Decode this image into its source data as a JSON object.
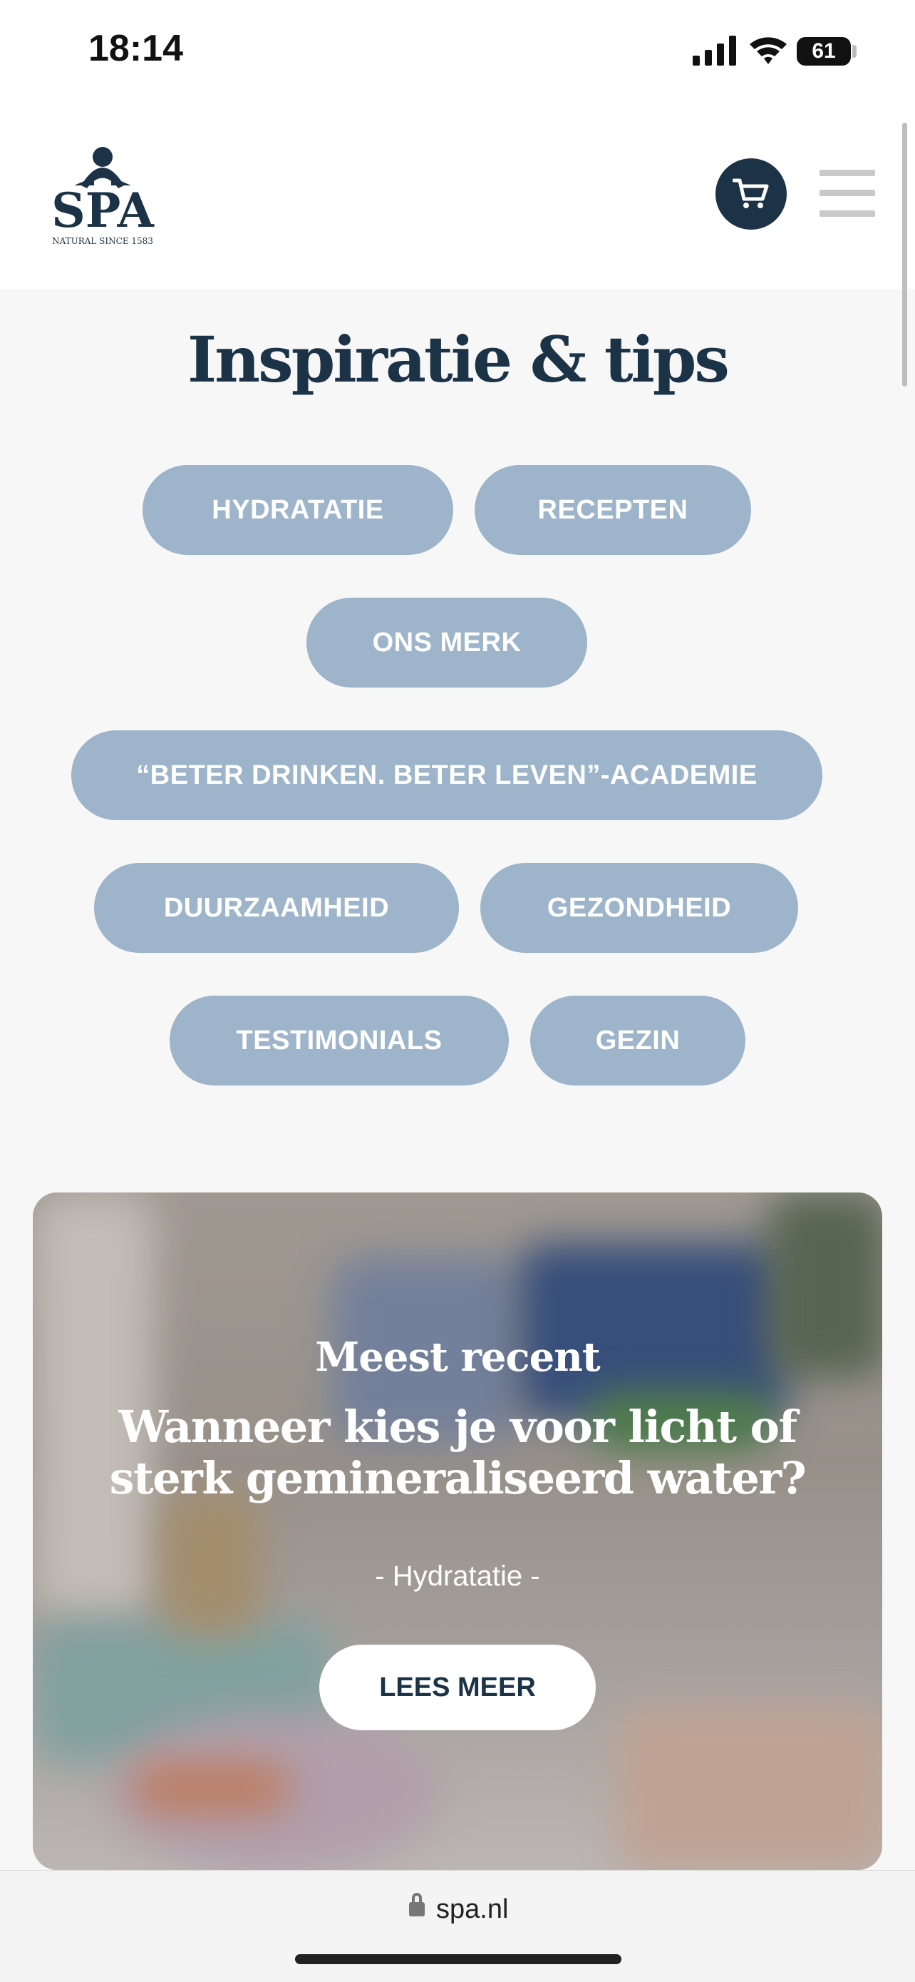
{
  "status_bar": {
    "time": "18:14",
    "battery": "61"
  },
  "header": {
    "logo_text": "SPA",
    "logo_tagline": "NATURAL SINCE 1583"
  },
  "page_title": "Inspiratie & tips",
  "categories": [
    "HYDRATATIE",
    "RECEPTEN",
    "ONS MERK",
    "“BETER DRINKEN. BETER LEVEN”-ACADEMIE",
    "DUURZAAMHEID",
    "GEZONDHEID",
    "TESTIMONIALS",
    "GEZIN"
  ],
  "hero": {
    "kicker": "Meest recent",
    "title": "Wanneer kies je voor licht of sterk gemineraliseerd water?",
    "category": "- Hydratatie -",
    "button_label": "LEES MEER"
  },
  "browser": {
    "url": "spa.nl"
  },
  "colors": {
    "brand_navy": "#1c3347",
    "chip": "#9db4cb"
  }
}
